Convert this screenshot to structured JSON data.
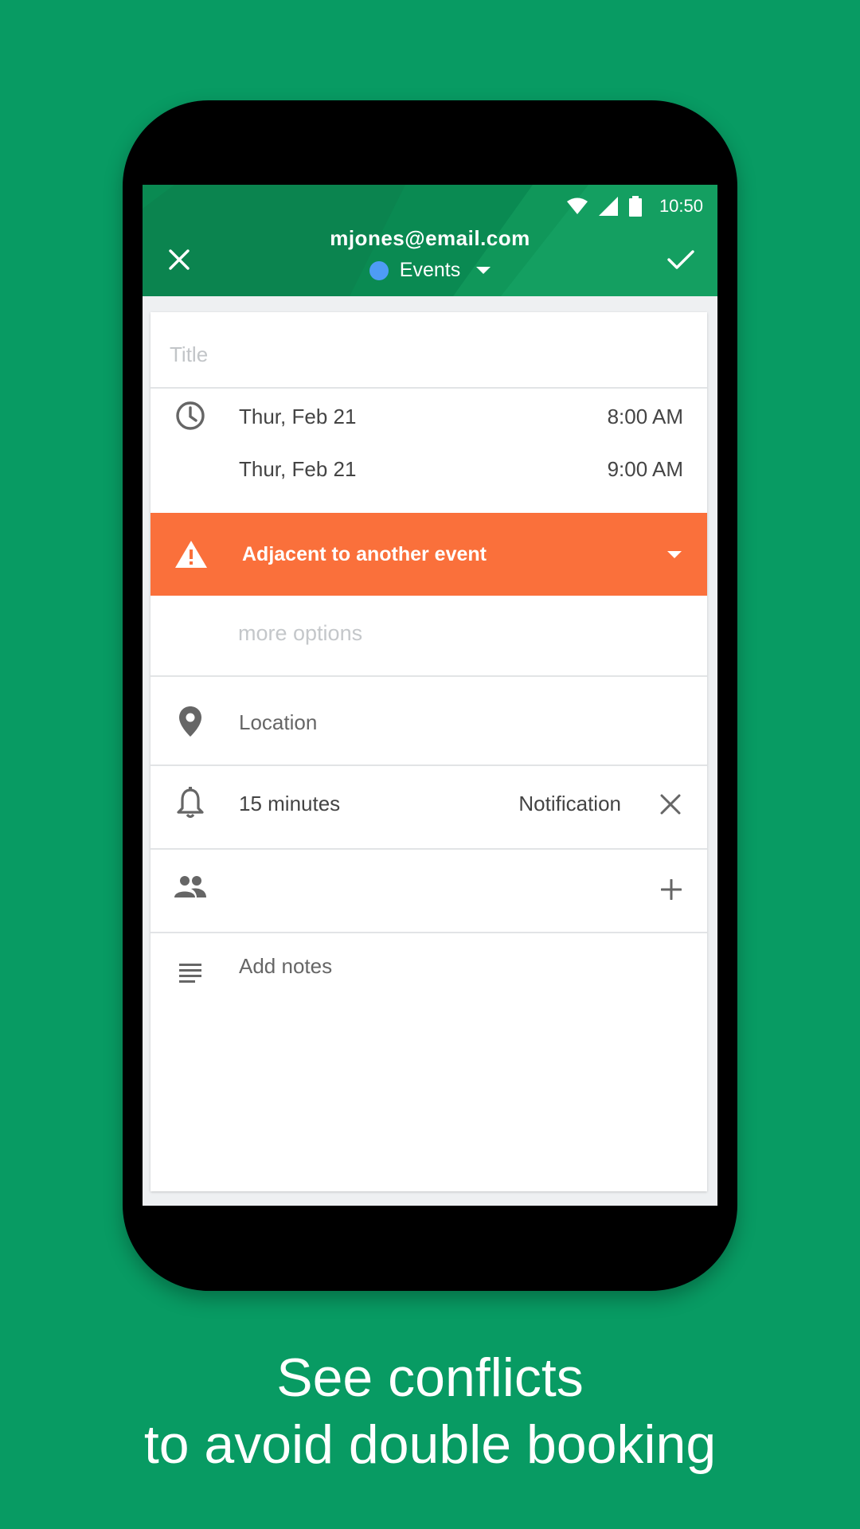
{
  "status_bar": {
    "time": "10:50"
  },
  "app_bar": {
    "account": "mjones@email.com",
    "calendar_name": "Events",
    "calendar_color": "#4e9cf5"
  },
  "form": {
    "title_placeholder": "Title",
    "start": {
      "date": "Thur, Feb 21",
      "time": "8:00 AM"
    },
    "end": {
      "date": "Thur, Feb 21",
      "time": "9:00 AM"
    },
    "conflict_message": "Adjacent to another event",
    "more_options": "more options",
    "location_placeholder": "Location",
    "notification": {
      "value": "15 minutes",
      "type": "Notification"
    },
    "notes_placeholder": "Add notes"
  },
  "colors": {
    "background": "#089b63",
    "app_bar": "#0a8a52",
    "conflict_banner": "#fa703b"
  },
  "caption": {
    "line1": "See conflicts",
    "line2": "to avoid double booking"
  }
}
